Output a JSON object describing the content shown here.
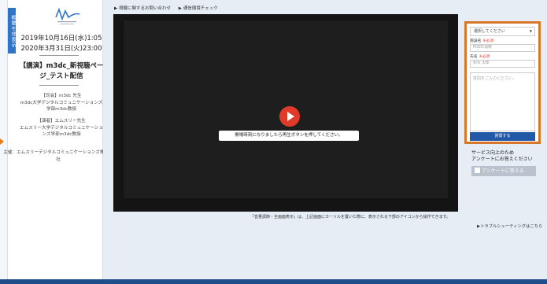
{
  "sidebar": {
    "toggle_label": "概要を非表示",
    "start_datetime": "2019年10月16日(水)1:05",
    "end_datetime": "2020年3月31日(火)23:00",
    "title": "【講演】m3dc_新視聴ページ_テスト配信",
    "moderator": "【司会】m3dc 先生\nm3dc大学デジタルコミュニケーションズ学部m3dc教授",
    "speaker": "【演者】エムスリー先生\nエムスリー大学デジタルコミュニケーションズ学部m3dc教授",
    "sponsor": "主催：エムスリーデジタルコミュニケーションズ株式会社"
  },
  "toplinks": {
    "contact": "▶ 視聴に関するお問い合わせ",
    "env_check": "▶ 通信環境チェック"
  },
  "player": {
    "notice": "開場時刻になりましたら再生ボタンを押してください。",
    "caption": "「音量調節・全画面表示」は、上記画面にカーソルを置いた際に、表示される下部のアイコンから操作できます。"
  },
  "question_form": {
    "select_placeholder": "選択してください",
    "hospital_label": "施設名",
    "hospital_value": "M3DC病院",
    "name_label": "氏名",
    "name_value": "鈴木 太郎",
    "required": "※必須",
    "textarea_placeholder": "質問をご入力ください。",
    "submit_label": "質問する"
  },
  "survey": {
    "line1": "サービス向上のため",
    "line2": "アンケートにお答えください",
    "button_label": "アンケートに答える"
  },
  "trouble_link": "▶トラブルシューティングはこちら",
  "colors": {
    "accent": "#d7772a",
    "primary": "#2158a8",
    "play": "#e03a2a"
  }
}
